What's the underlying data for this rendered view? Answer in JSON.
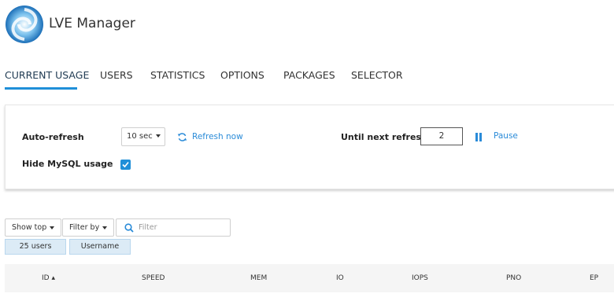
{
  "app": {
    "title": "LVE Manager"
  },
  "tabs": [
    {
      "label": "CURRENT USAGE",
      "active": true
    },
    {
      "label": "USERS"
    },
    {
      "label": "STATISTICS"
    },
    {
      "label": "OPTIONS"
    },
    {
      "label": "PACKAGES"
    },
    {
      "label": "SELECTOR"
    }
  ],
  "settings": {
    "auto_refresh_label": "Auto-refresh",
    "interval_value": "10 sec",
    "refresh_now_label": "Refresh now",
    "until_next_label": "Until next refresh",
    "until_next_value": "2",
    "pause_label": "Pause",
    "hide_mysql_label": "Hide MySQL usage",
    "hide_mysql_checked": true
  },
  "toolbar": {
    "show_top_label": "Show top",
    "filter_by_label": "Filter by",
    "filter_placeholder": "Filter",
    "chips": [
      "25 users",
      "Username"
    ]
  },
  "table": {
    "columns": [
      "ID ▴",
      "SPEED",
      "MEM",
      "IO",
      "IOPS",
      "PNO",
      "EP"
    ]
  },
  "colors": {
    "accent": "#1f8fd8",
    "chip_bg": "#dcebf6",
    "link": "#2a8bd8"
  }
}
